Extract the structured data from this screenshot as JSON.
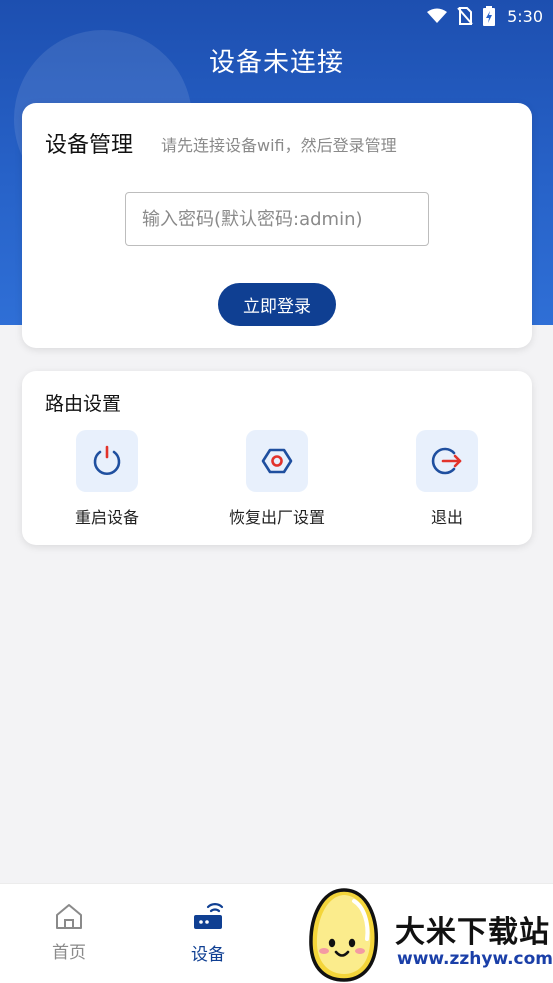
{
  "status_bar": {
    "time": "5:30",
    "icons": [
      "wifi-icon",
      "no-sim-icon",
      "battery-charging-icon"
    ]
  },
  "header": {
    "title": "设备未连接"
  },
  "login_card": {
    "title": "设备管理",
    "hint": "请先连接设备wifi，然后登录管理",
    "password_placeholder": "输入密码(默认密码:admin)",
    "password_value": "",
    "login_button": "立即登录"
  },
  "router_card": {
    "title": "路由设置",
    "actions": [
      {
        "label": "重启设备",
        "icon": "power-icon"
      },
      {
        "label": "恢复出厂设置",
        "icon": "hexagon-reset-icon"
      },
      {
        "label": "退出",
        "icon": "logout-icon"
      }
    ]
  },
  "bottom_nav": {
    "items": [
      {
        "label": "首页",
        "icon": "home-icon",
        "active": false
      },
      {
        "label": "设备",
        "icon": "router-icon",
        "active": true
      }
    ]
  },
  "watermark": {
    "title": "大米下载站",
    "url": "www.zzhyw.com"
  },
  "colors": {
    "header_gradient_top": "#1d4fb0",
    "header_gradient_bottom": "#2f6fd6",
    "primary_button": "#0f3f92",
    "icon_blue": "#1f4f9f",
    "icon_accent_red": "#e2332b",
    "icon_tile_bg": "#e8f0fc",
    "nav_active": "#0f3f92",
    "nav_inactive": "#8a8a8a"
  }
}
